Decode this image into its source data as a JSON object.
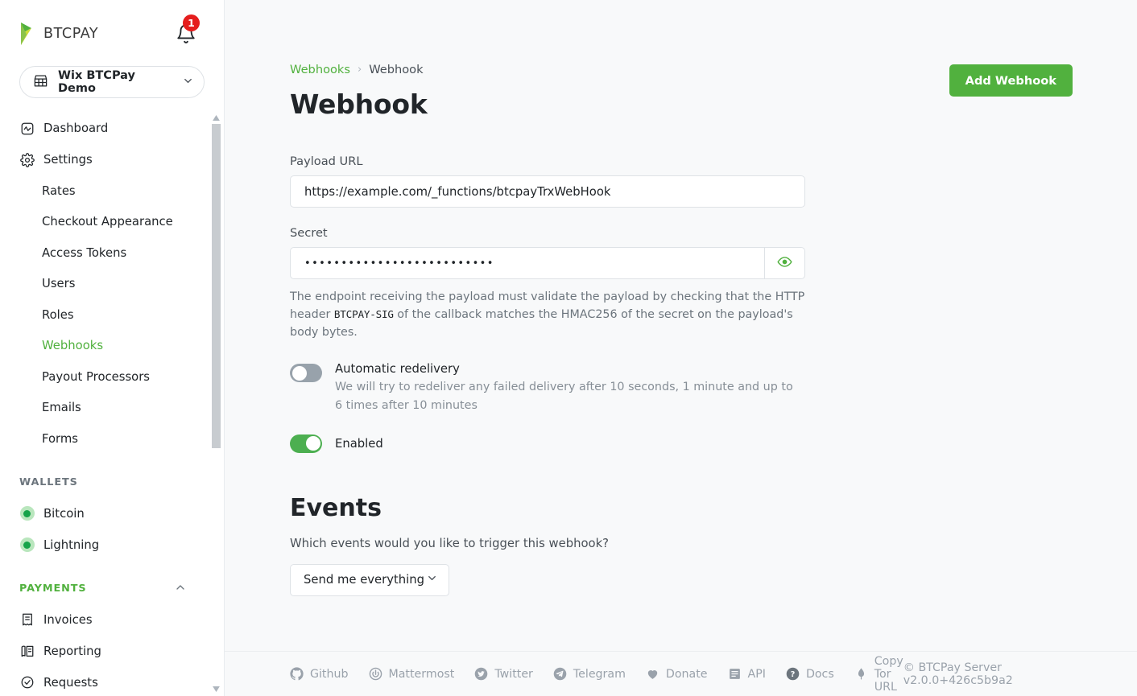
{
  "brand": {
    "logo_icon": "btcpay-logo-icon",
    "name": "BTCPAY",
    "bell_icon": "bell-icon",
    "notification_count": "1"
  },
  "store_selector": {
    "icon": "store-icon",
    "name": "Wix BTCPay Demo",
    "chevron": "chevron-down-icon"
  },
  "sidebar": {
    "items": [
      {
        "label": "Dashboard",
        "icon": "dashboard-icon",
        "type": "top",
        "active": false
      },
      {
        "label": "Settings",
        "icon": "gear-icon",
        "type": "top",
        "active": false
      },
      {
        "label": "Rates",
        "icon": "",
        "type": "sub",
        "active": false
      },
      {
        "label": "Checkout Appearance",
        "icon": "",
        "type": "sub",
        "active": false
      },
      {
        "label": "Access Tokens",
        "icon": "",
        "type": "sub",
        "active": false
      },
      {
        "label": "Users",
        "icon": "",
        "type": "sub",
        "active": false
      },
      {
        "label": "Roles",
        "icon": "",
        "type": "sub",
        "active": false
      },
      {
        "label": "Webhooks",
        "icon": "",
        "type": "sub",
        "active": true
      },
      {
        "label": "Payout Processors",
        "icon": "",
        "type": "sub",
        "active": false
      },
      {
        "label": "Emails",
        "icon": "",
        "type": "sub",
        "active": false
      },
      {
        "label": "Forms",
        "icon": "",
        "type": "sub",
        "active": false
      }
    ],
    "wallets_section": {
      "label": "WALLETS"
    },
    "wallets": [
      {
        "label": "Bitcoin",
        "icon": "status-dot-icon"
      },
      {
        "label": "Lightning",
        "icon": "status-dot-icon"
      }
    ],
    "payments_section": {
      "label": "PAYMENTS",
      "chevron": "chevron-up-icon"
    },
    "payments": [
      {
        "label": "Invoices",
        "icon": "invoice-icon"
      },
      {
        "label": "Reporting",
        "icon": "reporting-icon"
      },
      {
        "label": "Requests",
        "icon": "requests-icon"
      }
    ]
  },
  "header": {
    "breadcrumb": {
      "parent": "Webhooks",
      "separator": "›",
      "current": "Webhook"
    },
    "title": "Webhook",
    "add_button": "Add Webhook"
  },
  "form": {
    "payload_url_label": "Payload URL",
    "payload_url_value": "https://example.com/_functions/btcpayTrxWebHook",
    "secret_label": "Secret",
    "secret_value": "••••••••••••••••••••••••••",
    "secret_toggle_icon": "eye-icon",
    "secret_help_part1": "The endpoint receiving the payload must validate the payload by checking that the HTTP header ",
    "secret_help_code": "BTCPAY-SIG",
    "secret_help_part2": " of the callback matches the HMAC256 of the secret on the payload's body bytes.",
    "auto_redelivery": {
      "title": "Automatic redelivery",
      "description": "We will try to redeliver any failed delivery after 10 seconds, 1 minute and up to 6 times after 10 minutes",
      "state": "off"
    },
    "enabled": {
      "title": "Enabled",
      "state": "on"
    }
  },
  "events": {
    "title": "Events",
    "question": "Which events would you like to trigger this webhook?",
    "selected": "Send me everything",
    "chevron": "chevron-down-icon"
  },
  "footer": {
    "links": [
      {
        "label": "Github",
        "icon": "github-icon"
      },
      {
        "label": "Mattermost",
        "icon": "mattermost-icon"
      },
      {
        "label": "Twitter",
        "icon": "twitter-icon"
      },
      {
        "label": "Telegram",
        "icon": "telegram-icon"
      },
      {
        "label": "Donate",
        "icon": "heart-icon"
      },
      {
        "label": "API",
        "icon": "api-icon"
      },
      {
        "label": "Docs",
        "icon": "question-circle-icon"
      },
      {
        "label": "Copy Tor URL",
        "icon": "tor-icon"
      }
    ],
    "copyright": "© BTCPay Server v2.0.0+426c5b9a2"
  },
  "colors": {
    "accent_green": "#51b13e",
    "toggle_green": "#4caf50",
    "badge_red": "#e51d1d",
    "page_bg": "#f8f9fa"
  }
}
